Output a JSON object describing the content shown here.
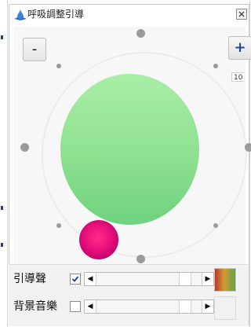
{
  "window": {
    "title": "呼吸調整引導",
    "app_icon": "teardrop-icon",
    "close_icon": "close-icon"
  },
  "controls": {
    "minus_label": "-",
    "plus_label": "+",
    "tooltip_text": "10"
  },
  "settings": [
    {
      "label": "引導聲",
      "checked": true
    },
    {
      "label": "背景音樂",
      "checked": false
    }
  ],
  "colors": {
    "breath_circle": "#8ee08f",
    "pink_ball": "#e8107a",
    "plus_accent": "#1b43a8",
    "checkbox_check": "#1b43a8"
  }
}
